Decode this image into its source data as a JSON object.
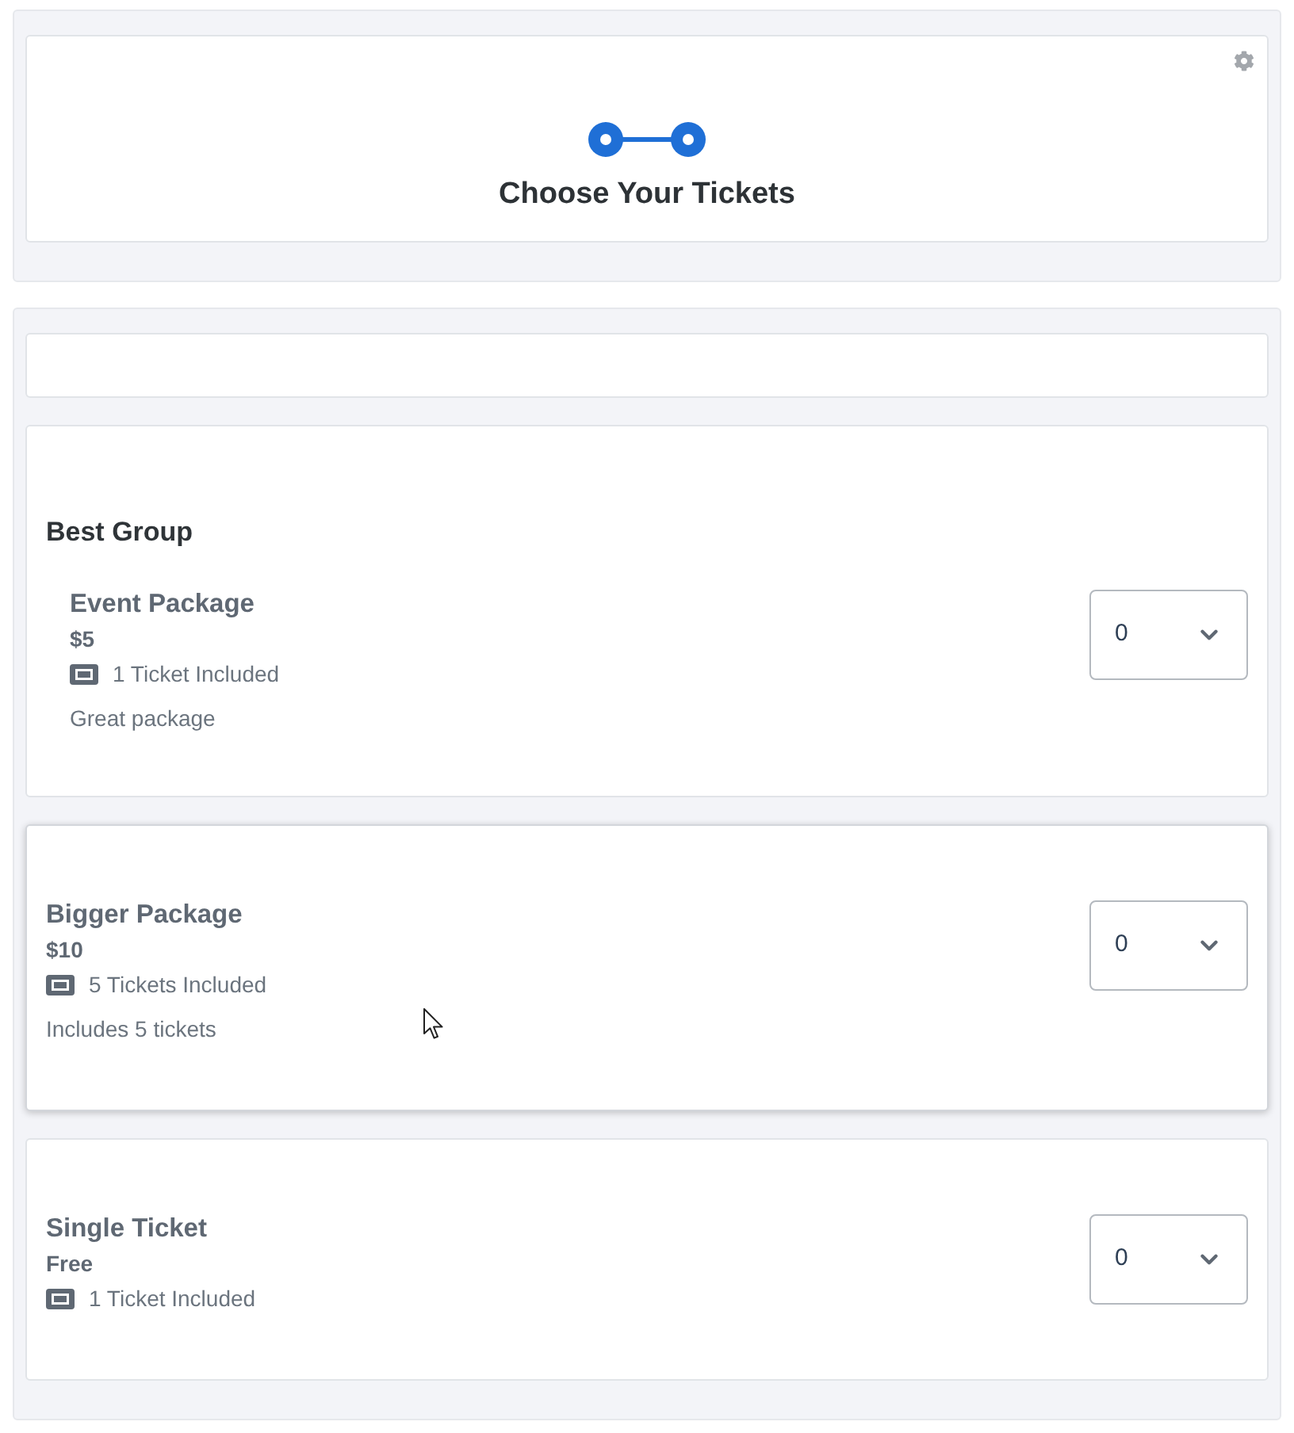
{
  "header": {
    "title": "Choose Your Tickets"
  },
  "sections": [
    {
      "kind": "blank"
    },
    {
      "kind": "group",
      "title": "Best Group",
      "packages": [
        {
          "name": "Event Package",
          "price": "$5",
          "tickets": "1 Ticket Included",
          "description": "Great package",
          "quantity": "0"
        }
      ]
    },
    {
      "kind": "package",
      "name": "Bigger Package",
      "price": "$10",
      "tickets": "5 Tickets Included",
      "description": "Includes 5 tickets",
      "quantity": "0",
      "hovered": true
    },
    {
      "kind": "package",
      "name": "Single Ticket",
      "price": "Free",
      "tickets": "1 Ticket Included",
      "quantity": "0",
      "hovered": false
    }
  ]
}
